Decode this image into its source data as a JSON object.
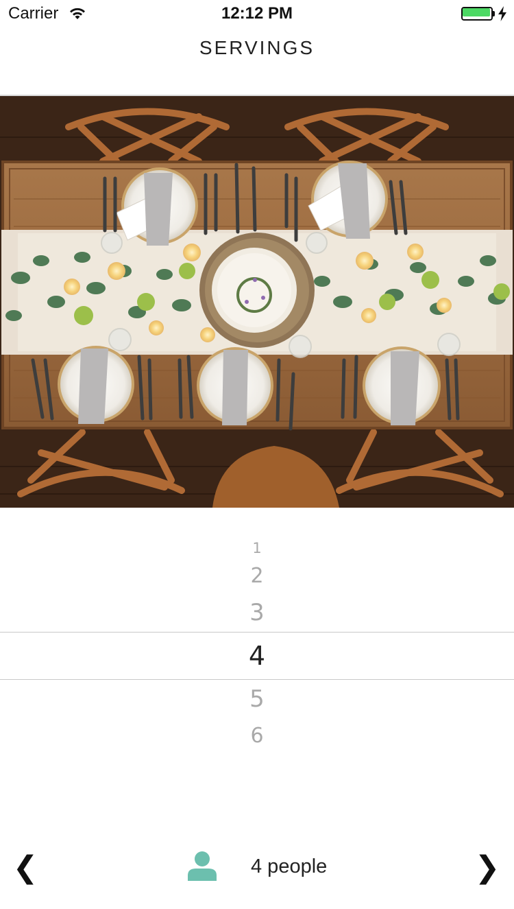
{
  "status_bar": {
    "carrier": "Carrier",
    "time": "12:12 PM",
    "battery_level": 1.0,
    "battery_color": "#4cd964",
    "wifi_icon": "wifi-icon",
    "charging_icon": "bolt-icon"
  },
  "nav": {
    "title": "SERVINGS"
  },
  "hero": {
    "icon": "dinner-table-photo"
  },
  "picker": {
    "options": [
      "1",
      "2",
      "3",
      "4",
      "5",
      "6"
    ],
    "selected": "4"
  },
  "bottom_bar": {
    "prev_label": "❮",
    "next_label": "❯",
    "person_icon": "person-icon",
    "person_icon_color": "#6cbfae",
    "servings_text": "4 people"
  }
}
